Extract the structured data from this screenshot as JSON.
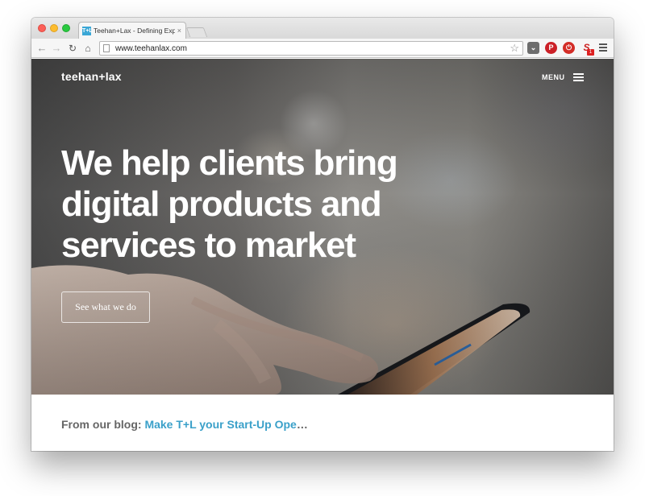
{
  "browser": {
    "tab": {
      "favicon_label": "T+L",
      "title": "Teehan+Lax - Defining Exp",
      "close_glyph": "×"
    },
    "nav": {
      "back_glyph": "←",
      "forward_glyph": "→",
      "reload_glyph": "↻",
      "home_glyph": "⌂"
    },
    "url": "www.teehanlax.com",
    "bookmark_glyph": "☆",
    "extensions": {
      "pocket_glyph": "⌄",
      "pinterest_glyph": "P",
      "lastpass_glyph": "⏻",
      "s_glyph": "S",
      "badge_count": "1"
    }
  },
  "site": {
    "logo": "teehan+lax",
    "menu_label": "MENU",
    "headline": "We help clients bring digital products and services to market",
    "cta_label": "See what we do",
    "blog": {
      "prefix": "From our blog: ",
      "link_text": "Make T+L your Start-Up Ope",
      "ellipsis": "…"
    }
  },
  "colors": {
    "accent_link": "#3aa0c9",
    "hero_text": "#ffffff",
    "blog_prefix": "#666666"
  }
}
